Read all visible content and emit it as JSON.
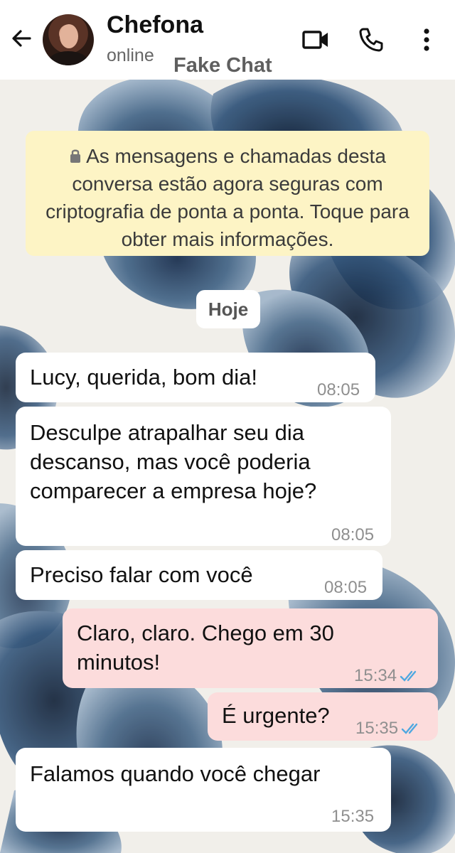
{
  "header": {
    "contact_name": "Chefona",
    "status": "online",
    "watermark": "Fake Chat",
    "icons": [
      "back-arrow-icon",
      "video-call-icon",
      "phone-call-icon",
      "more-options-icon"
    ]
  },
  "chat": {
    "encryption_notice": "As mensagens e chamadas desta conversa estão agora seguras com criptografia de ponta a ponta. Toque para obter mais informações.",
    "day_label": "Hoje",
    "messages": [
      {
        "direction": "incoming",
        "lines": [
          "Lucy, querida, bom dia!"
        ],
        "time": "08:05"
      },
      {
        "direction": "incoming",
        "lines": [
          "Desculpe atrapalhar seu dia",
          "descanso, mas você poderia",
          "comparecer a empresa hoje?"
        ],
        "time": "08:05"
      },
      {
        "direction": "incoming",
        "lines": [
          "Preciso falar com você"
        ],
        "time": "08:05"
      },
      {
        "direction": "outgoing",
        "lines": [
          "Claro, claro. Chego em 30",
          "minutos!"
        ],
        "time": "15:34",
        "status": "read"
      },
      {
        "direction": "outgoing",
        "lines": [
          "É urgente?"
        ],
        "time": "15:35",
        "status": "read"
      },
      {
        "direction": "incoming",
        "lines": [
          "Falamos quando você chegar"
        ],
        "time": "15:35"
      }
    ]
  },
  "colors": {
    "header_bg": "#ffffff",
    "notice_bg": "#fdf4c5",
    "incoming_bubble": "#ffffff",
    "outgoing_bubble": "#fcdcdc",
    "read_ticks": "#4fa8e0",
    "wallpaper_flower": "#2f4a6e"
  }
}
